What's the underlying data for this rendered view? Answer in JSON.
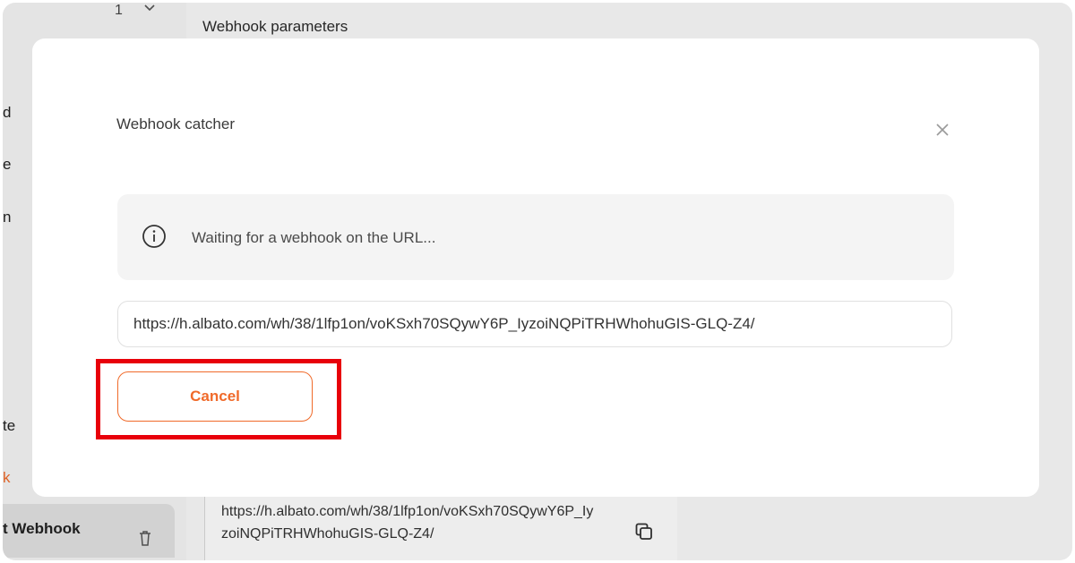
{
  "background": {
    "section_title": "Webhook parameters",
    "step_number": "1",
    "sidebar_fragments": [
      "d",
      "e",
      "n",
      "te",
      "k"
    ],
    "active_item_label": "t Webhook",
    "url_text": "https://h.albato.com/wh/38/1lfp1on/voKSxh70SQywY6P_IyzoiNQPiTRHWhohuGIS-GLQ-Z4/"
  },
  "modal": {
    "title": "Webhook catcher",
    "info_text": "Waiting for a webhook on the URL...",
    "url_value": "https://h.albato.com/wh/38/1lfp1on/voKSxh70SQywY6P_IyzoiNQPiTRHWhohuGIS-GLQ-Z4/",
    "cancel_label": "Cancel"
  },
  "icons": {
    "close": "close-icon",
    "info": "info-icon",
    "copy": "copy-icon",
    "trash": "trash-icon",
    "chevron": "chevron-down-icon"
  },
  "colors": {
    "accent": "#f06a2a",
    "highlight": "#e8000a"
  }
}
